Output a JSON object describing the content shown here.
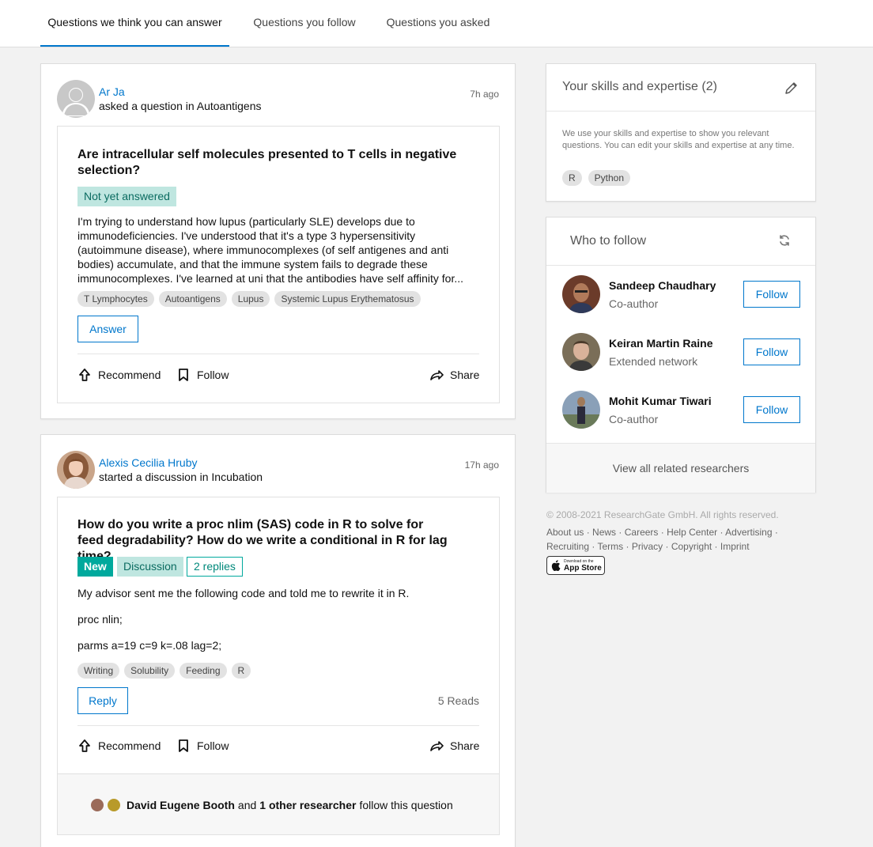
{
  "tabs": [
    {
      "label": "Questions we think you can answer"
    },
    {
      "label": "Questions you follow"
    },
    {
      "label": "Questions you asked"
    }
  ],
  "feed": [
    {
      "author": "Ar Ja",
      "action": "asked a question in Autoantigens",
      "time": "7h ago",
      "title": "Are intracellular self molecules presented to T cells in negative selection?",
      "status_badge": "Not yet answered",
      "body": "I'm trying to understand how lupus (particularly SLE) develops due to immunodeficiencies. I've understood that it's a type 3 hypersensitivity (autoimmune disease), where immunocomplexes (of self antigenes and anti bodies) accumulate, and that the immune system fails to degrade these immunocomplexes. I've learned at uni that the antibodies have self affinity for...",
      "tags": [
        "T Lymphocytes",
        "Autoantigens",
        "Lupus",
        "Systemic Lupus Erythematosus"
      ],
      "primary_button": "Answer",
      "actions": {
        "recommend": "Recommend",
        "follow": "Follow",
        "share": "Share"
      }
    },
    {
      "author": "Alexis Cecilia Hruby",
      "action": "started a discussion in Incubation",
      "time": "17h ago",
      "title": "How do you write a proc nlim (SAS) code in R to solve for feed degradability? How do we write a conditional in R for lag time?",
      "badges": {
        "new": "New",
        "discussion": "Discussion",
        "replies": "2 replies"
      },
      "body_lines": [
        "My advisor sent me the following code and told me to rewrite it in R.",
        "proc nlin;",
        "parms a=19 c=9 k=.08 lag=2;"
      ],
      "tags": [
        "Writing",
        "Solubility",
        "Feeding",
        "R"
      ],
      "primary_button": "Reply",
      "reads": "5 Reads",
      "actions": {
        "recommend": "Recommend",
        "follow": "Follow",
        "share": "Share"
      },
      "followers": {
        "name": "David Eugene Booth",
        "and": "and",
        "others": "1 other researcher",
        "suffix": "follow this question"
      }
    }
  ],
  "skills": {
    "title": "Your skills and expertise (2)",
    "text": "We use your skills and expertise to show you relevant questions. You can edit your skills and expertise at any time.",
    "tags": [
      "R",
      "Python"
    ]
  },
  "who_to_follow": {
    "title": "Who to follow",
    "people": [
      {
        "name": "Sandeep Chaudhary",
        "relation": "Co-author",
        "button": "Follow"
      },
      {
        "name": "Keiran Martin Raine",
        "relation": "Extended network",
        "button": "Follow"
      },
      {
        "name": "Mohit Kumar Tiwari",
        "relation": "Co-author",
        "button": "Follow"
      }
    ],
    "view_all": "View all related researchers"
  },
  "footer": {
    "copyright": "© 2008-2021 ResearchGate GmbH. All rights reserved.",
    "links": [
      "About us",
      "News",
      "Careers",
      "Help Center",
      "Advertising",
      "Recruiting",
      "Terms",
      "Privacy",
      "Copyright",
      "Imprint"
    ],
    "appstore_small": "Download on the",
    "appstore_big": "App Store"
  },
  "colors": {
    "accent": "#0077cc",
    "teal": "#00a99d",
    "badge_bg": "#bfe6e0"
  }
}
